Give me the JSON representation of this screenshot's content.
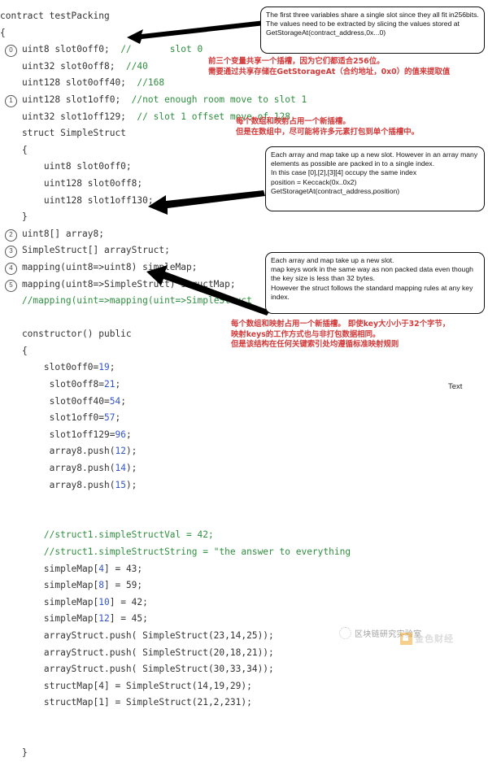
{
  "code": {
    "lines": [
      {
        "indent": 0,
        "text": "contract testPacking"
      },
      {
        "indent": 0,
        "text": "{"
      },
      {
        "indent": 1,
        "marker": "0",
        "text": "uint8 slot0off0;",
        "comment": "//       slot 0"
      },
      {
        "indent": 1,
        "text": "uint32 slot0off8;",
        "comment": "//40"
      },
      {
        "indent": 1,
        "text": "uint128 slot0off40;",
        "comment": "//168"
      },
      {
        "indent": 1,
        "marker": "1",
        "text": "uint128 slot1off0;",
        "comment": "//not enough room move to slot 1"
      },
      {
        "indent": 1,
        "text": "uint32 slot1off129;",
        "comment": "// slot 1 offset move of 128,"
      },
      {
        "indent": 1,
        "text": "struct SimpleStruct"
      },
      {
        "indent": 1,
        "text": "{"
      },
      {
        "indent": 2,
        "text": "uint8 slot0off0;"
      },
      {
        "indent": 2,
        "text": "uint128 slot0off8;"
      },
      {
        "indent": 2,
        "text": "uint128 slot1off130;"
      },
      {
        "indent": 1,
        "text": "}"
      },
      {
        "indent": 1,
        "marker": "2",
        "text": "uint8[] array8;"
      },
      {
        "indent": 1,
        "marker": "3",
        "text": "SimpleStruct[] arrayStruct;"
      },
      {
        "indent": 1,
        "marker": "4",
        "text": "mapping(uint8=>uint8) simpleMap;"
      },
      {
        "indent": 1,
        "marker": "5",
        "text": "mapping(uint8=>SimpleStruct) structMap;"
      },
      {
        "indent": 1,
        "comment": "//mapping(uint=>mapping(uint=>SimpleStruct"
      },
      {
        "indent": 1,
        "text": ""
      },
      {
        "indent": 1,
        "text": "constructor() public"
      },
      {
        "indent": 1,
        "text": "{"
      },
      {
        "indent": 2,
        "text": "slot0off0=",
        "value": "19",
        "tail": ";"
      },
      {
        "indent": 2,
        "text": " slot0off8=",
        "value": "21",
        "tail": ";"
      },
      {
        "indent": 2,
        "text": " slot0off40=",
        "value": "54",
        "tail": ";"
      },
      {
        "indent": 2,
        "text": " slot1off0=",
        "value": "57",
        "tail": ";"
      },
      {
        "indent": 2,
        "text": " slot1off129=",
        "value": "96",
        "tail": ";"
      },
      {
        "indent": 2,
        "text": " array8.push(",
        "value": "12",
        "tail": ");"
      },
      {
        "indent": 2,
        "text": " array8.push(",
        "value": "14",
        "tail": ");"
      },
      {
        "indent": 2,
        "text": " array8.push(",
        "value": "15",
        "tail": ");"
      },
      {
        "indent": 2,
        "text": ""
      },
      {
        "indent": 2,
        "text": ""
      },
      {
        "indent": 2,
        "comment": "//struct1.simpleStructVal = 42;"
      },
      {
        "indent": 2,
        "comment": "//struct1.simpleStructString = \"the answer to everything"
      },
      {
        "indent": 2,
        "text": "simpleMap[",
        "value": "4",
        "tail": "] = 43;"
      },
      {
        "indent": 2,
        "text": "simpleMap[",
        "value": "8",
        "tail": "] = 59;"
      },
      {
        "indent": 2,
        "text": "simpleMap[",
        "value": "10",
        "tail": "] = 42;"
      },
      {
        "indent": 2,
        "text": "simpleMap[",
        "value": "12",
        "tail": "] = 45;"
      },
      {
        "indent": 2,
        "text": "arrayStruct.push( SimpleStruct(23,14,25));"
      },
      {
        "indent": 2,
        "text": "arrayStruct.push( SimpleStruct(20,18,21));"
      },
      {
        "indent": 2,
        "text": "arrayStruct.push( SimpleStruct(30,33,34));"
      },
      {
        "indent": 2,
        "text": "structMap[4] = SimpleStruct(14,19,29);"
      },
      {
        "indent": 2,
        "text": "structMap[1] = SimpleStruct(21,2,231);"
      },
      {
        "indent": 2,
        "text": ""
      },
      {
        "indent": 2,
        "text": ""
      },
      {
        "indent": 1,
        "text": "}"
      }
    ]
  },
  "callouts": [
    {
      "id": "callout-slot-packing",
      "text": "The first three variables share a single slot since they all fit in256bits. The values need to be extracted by slicing the values stored at\nGetStorageAt(contract_address,0x...0)"
    },
    {
      "id": "callout-array-packing",
      "text": "Each array and map take up a new slot. However in an array many elements as possible are packed in to a single index.\nIn this case [0],[2],[3][4] occupy the same index\nposition = Keccack(0x..0x2)\nGetStoragetAt(contract_address,position)"
    },
    {
      "id": "callout-map-rules",
      "text": "Each array and map take up a new slot.\nmap keys work in the same way as non packed data even though the key size is less than 32 bytes.\nHowever the struct follows the standard mapping rules at any key index."
    }
  ],
  "chinese_notes": [
    {
      "id": "cn-note-slot-packing",
      "text": "前三个变量共享一个插槽，因为它们都适合256位。\n需要通过共享存储在GetStorageAt（合约地址，0x0）的值来提取值"
    },
    {
      "id": "cn-note-array-packing",
      "text": "每个数组和映射占用一个新插槽。\n但是在数组中，尽可能将许多元素打包到单个插槽中。"
    },
    {
      "id": "cn-note-map-rules",
      "text": "每个数组和映射占用一个新插槽。 即使key大小小于32个字节，\n映射keys的工作方式也与非打包数据相同。\n但是该结构在任何关键索引处均遵循标准映射规则"
    }
  ],
  "labels": {
    "text_label": "Text"
  },
  "watermark": {
    "lab_text": "区块链研究实验室",
    "brand_text": "金色财经"
  },
  "colors": {
    "comment_green": "#2f8f3f",
    "number_blue": "#3355cc",
    "annotation_red": "#d23a3a",
    "code_gray": "#333333"
  }
}
